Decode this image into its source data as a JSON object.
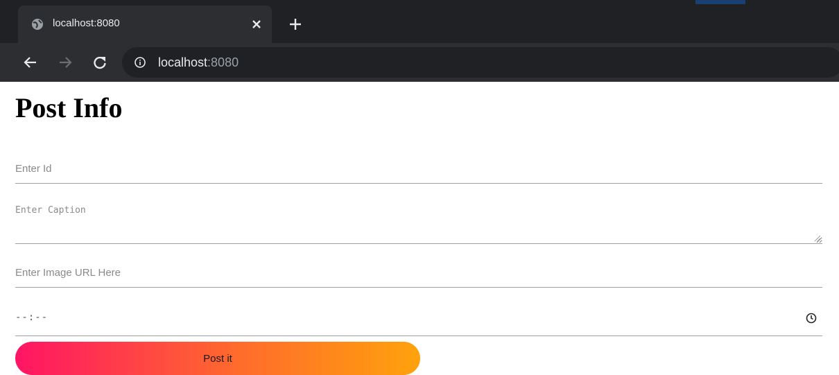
{
  "browser": {
    "tab_title": "localhost:8080",
    "url_host": "localhost",
    "url_port": ":8080"
  },
  "page": {
    "title": "Post Info"
  },
  "form": {
    "id_placeholder": "Enter Id",
    "caption_placeholder": "Enter Caption",
    "image_placeholder": "Enter Image URL Here",
    "time_value": "--:--",
    "submit_label": "Post it"
  },
  "colors": {
    "button_gradient_start": "#ff1464",
    "button_gradient_end": "#ffa20c",
    "chrome_dark": "#202124"
  },
  "icons": {
    "favicon": "globe-icon",
    "tab_close": "close-icon",
    "new_tab": "plus-icon",
    "back": "back-arrow-icon",
    "forward": "forward-arrow-icon",
    "reload": "reload-icon",
    "site_info": "info-icon",
    "time": "clock-icon"
  }
}
